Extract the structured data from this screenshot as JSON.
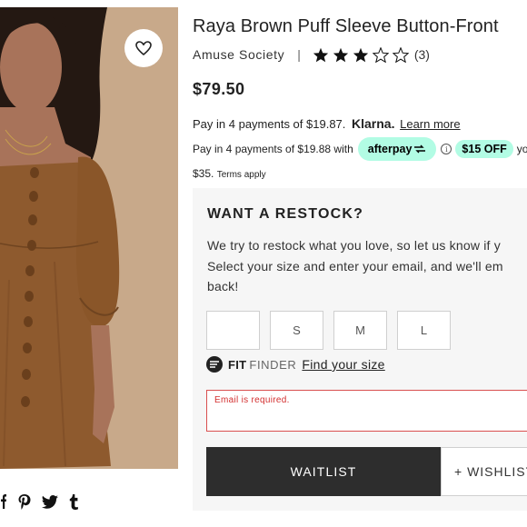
{
  "product": {
    "title": "Raya Brown Puff Sleeve Button-Front",
    "brand": "Amuse Society",
    "separator": "|",
    "rating": 3,
    "rating_max": 5,
    "review_count": "(3)",
    "price": "$79.50"
  },
  "klarna": {
    "text": "Pay in 4 payments of $19.87.",
    "logo": "Klarna.",
    "learn_more": "Learn more"
  },
  "afterpay": {
    "text": "Pay in 4 payments of $19.88 with",
    "logo": "afterpay",
    "info_glyph": "i",
    "offer": "$15 OFF",
    "tail": "yo",
    "terms_amount": "$35.",
    "terms_link": "Terms apply"
  },
  "restock": {
    "heading": "WANT A RESTOCK?",
    "lines": [
      "We try to restock what you love, so let us know if y",
      "Select your size and enter your email, and we'll em",
      "back!"
    ],
    "sizes": [
      "",
      "S",
      "M",
      "L"
    ],
    "fit_logo": "FIT",
    "fit_sub": "FINDER",
    "fit_link": "Find your size",
    "email_error": "Email is required.",
    "email_value": "",
    "waitlist_label": "WAITLIST",
    "wishlist_label": "+ WISHLIST"
  },
  "share": {
    "icons": [
      "facebook-icon",
      "pinterest-icon",
      "twitter-icon",
      "tumblr-icon"
    ],
    "glyphs": [
      "f",
      "P",
      "",
      "t"
    ]
  },
  "colors": {
    "afterpay_mint": "#b2fce4",
    "error_red": "#d94f4f",
    "button_dark": "#2d2d2d",
    "card_bg": "#f6f6f6"
  }
}
